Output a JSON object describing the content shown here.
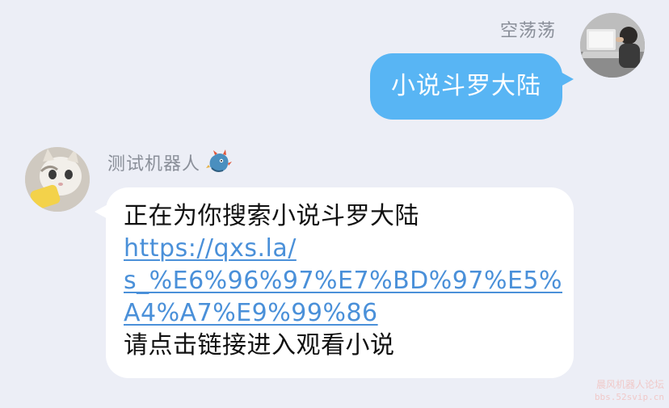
{
  "outgoing": {
    "sender_name": "空荡荡",
    "message": "小说斗罗大陆"
  },
  "incoming": {
    "sender_name": "测试机器人",
    "lines": {
      "intro": "正在为你搜索小说斗罗大陆",
      "link_line1": "https://qxs.la/",
      "link_line2": "s_%E6%96%97%E7%BD%97%E5%",
      "link_line3": "A4%A7%E9%99%86",
      "outro": "请点击链接进入观看小说"
    }
  },
  "watermark": {
    "line1": "晨风机器人论坛",
    "line2": "bbs.52svip.cn"
  },
  "icons": {
    "my_avatar": "user-avatar-icon",
    "bot_avatar": "bot-avatar-icon",
    "bot_badge": "dragon-badge-icon"
  },
  "colors": {
    "background": "#eceef6",
    "outgoing_bubble": "#58b5f4",
    "incoming_bubble": "#ffffff",
    "link": "#4a90d9",
    "name_text": "#8a8f99"
  }
}
